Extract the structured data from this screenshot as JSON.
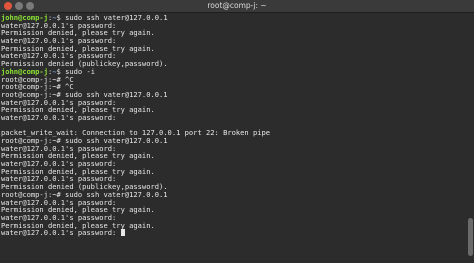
{
  "window": {
    "title": "root@comp-j: ~"
  },
  "terminal": {
    "lines": [
      {
        "type": "prompt",
        "user": "john@comp-j",
        "sep": ":",
        "path": "~",
        "sym": "$ ",
        "cmd": "sudo ssh vater@127.0.0.1"
      },
      {
        "type": "text",
        "text": "water@127.0.0.1's password:"
      },
      {
        "type": "text",
        "text": "Permission denied, please try again."
      },
      {
        "type": "text",
        "text": "water@127.0.0.1's password:"
      },
      {
        "type": "text",
        "text": "Permission denied, please try again."
      },
      {
        "type": "text",
        "text": "water@127.0.0.1's password:"
      },
      {
        "type": "text",
        "text": "Permission denied (publickey,password)."
      },
      {
        "type": "prompt",
        "user": "john@comp-j",
        "sep": ":",
        "path": "~",
        "sym": "$ ",
        "cmd": "sudo -i"
      },
      {
        "type": "text",
        "text": "root@comp-j:~# ^C"
      },
      {
        "type": "text",
        "text": "root@comp-j:~# ^C"
      },
      {
        "type": "text",
        "text": "root@comp-j:~# sudo ssh vater@127.0.0.1"
      },
      {
        "type": "text",
        "text": "water@127.0.0.1's password:"
      },
      {
        "type": "text",
        "text": "Permission denied, please try again."
      },
      {
        "type": "text",
        "text": "water@127.0.0.1's password:"
      },
      {
        "type": "text",
        "text": ""
      },
      {
        "type": "text",
        "text": "packet_write_wait: Connection to 127.0.0.1 port 22: Broken pipe"
      },
      {
        "type": "text",
        "text": "root@comp-j:~# sudo ssh vater@127.0.0.1"
      },
      {
        "type": "text",
        "text": "water@127.0.0.1's password:"
      },
      {
        "type": "text",
        "text": "Permission denied, please try again."
      },
      {
        "type": "text",
        "text": "water@127.0.0.1's password:"
      },
      {
        "type": "text",
        "text": "Permission denied, please try again."
      },
      {
        "type": "text",
        "text": "water@127.0.0.1's password:"
      },
      {
        "type": "text",
        "text": "Permission denied (publickey,password)."
      },
      {
        "type": "text",
        "text": "root@comp-j:~# sudo ssh vater@127.0.0.1"
      },
      {
        "type": "text",
        "text": "water@127.0.0.1's password:"
      },
      {
        "type": "text",
        "text": "Permission denied, please try again."
      },
      {
        "type": "text",
        "text": "water@127.0.0.1's password:"
      },
      {
        "type": "text",
        "text": "Permission denied, please try again."
      },
      {
        "type": "cursor",
        "text": "water@127.0.0.1's password: "
      }
    ]
  }
}
